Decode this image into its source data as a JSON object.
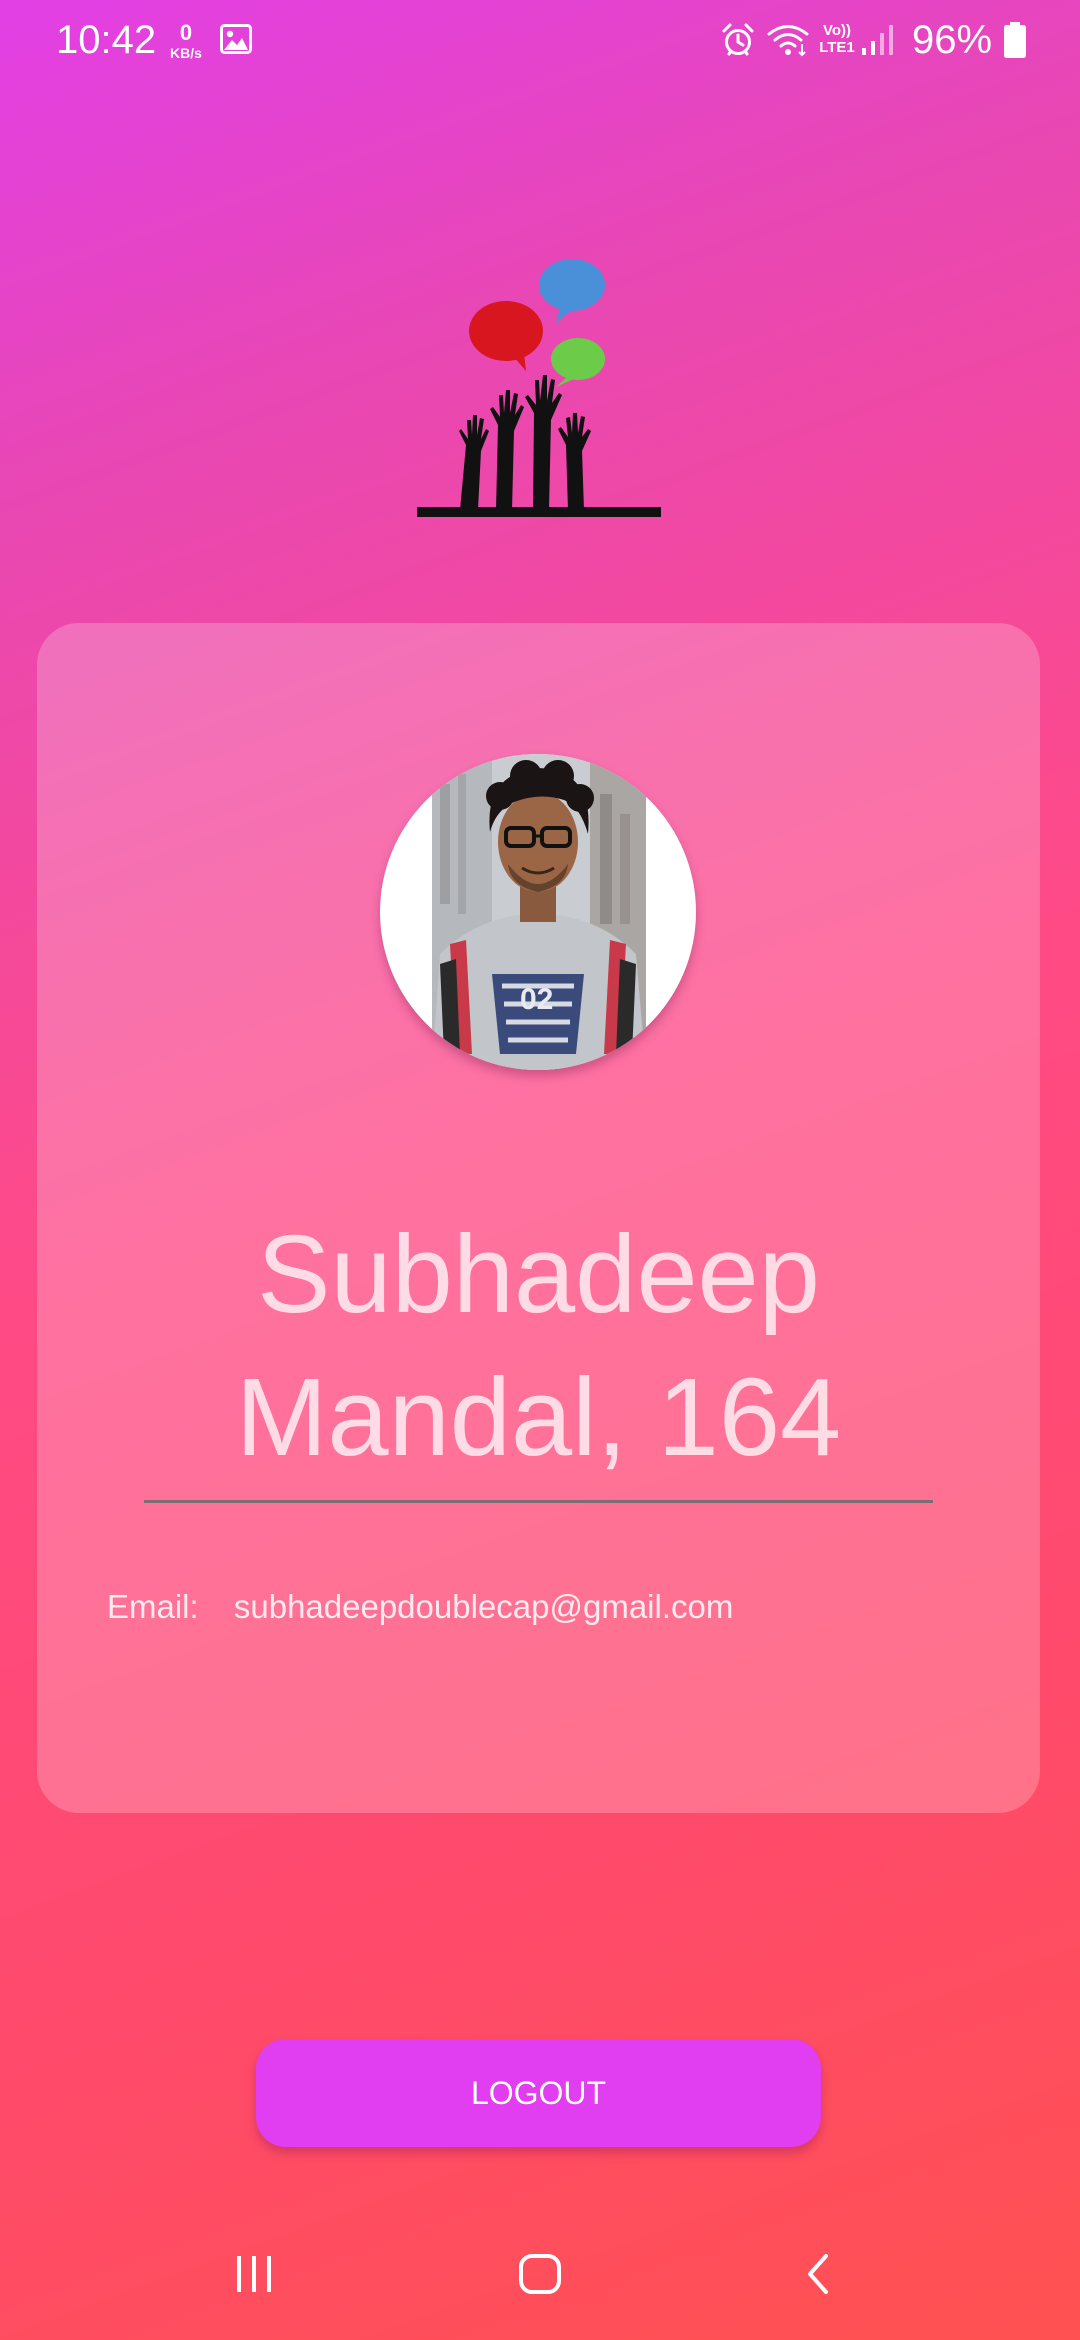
{
  "status_bar": {
    "time": "10:42",
    "net_speed_value": "0",
    "net_speed_unit": "KB/s",
    "volte_line1": "Vo))",
    "volte_line2": "LTE1",
    "battery_percent": "96%",
    "icons": [
      "gallery-icon",
      "alarm-icon",
      "wifi-icon",
      "signal-icon",
      "battery-icon"
    ]
  },
  "logo": {
    "icon": "raised-hands-speech-bubbles-logo",
    "bubble_colors": [
      "#d7161f",
      "#4a90d9",
      "#6ccc4a"
    ]
  },
  "profile": {
    "name_line1": "Subhadeep",
    "name_line2": "Mandal, 164",
    "email_label": "Email:",
    "email_value": "subhadeepdoublecap@gmail.com"
  },
  "actions": {
    "logout_label": "LOGOUT"
  },
  "colors": {
    "gradient_top": "#e23fe6",
    "gradient_bottom": "#ff5151",
    "logout_button": "#e03ef0"
  },
  "nav_bar": {
    "icons": [
      "recent-apps-icon",
      "home-icon",
      "back-icon"
    ]
  }
}
